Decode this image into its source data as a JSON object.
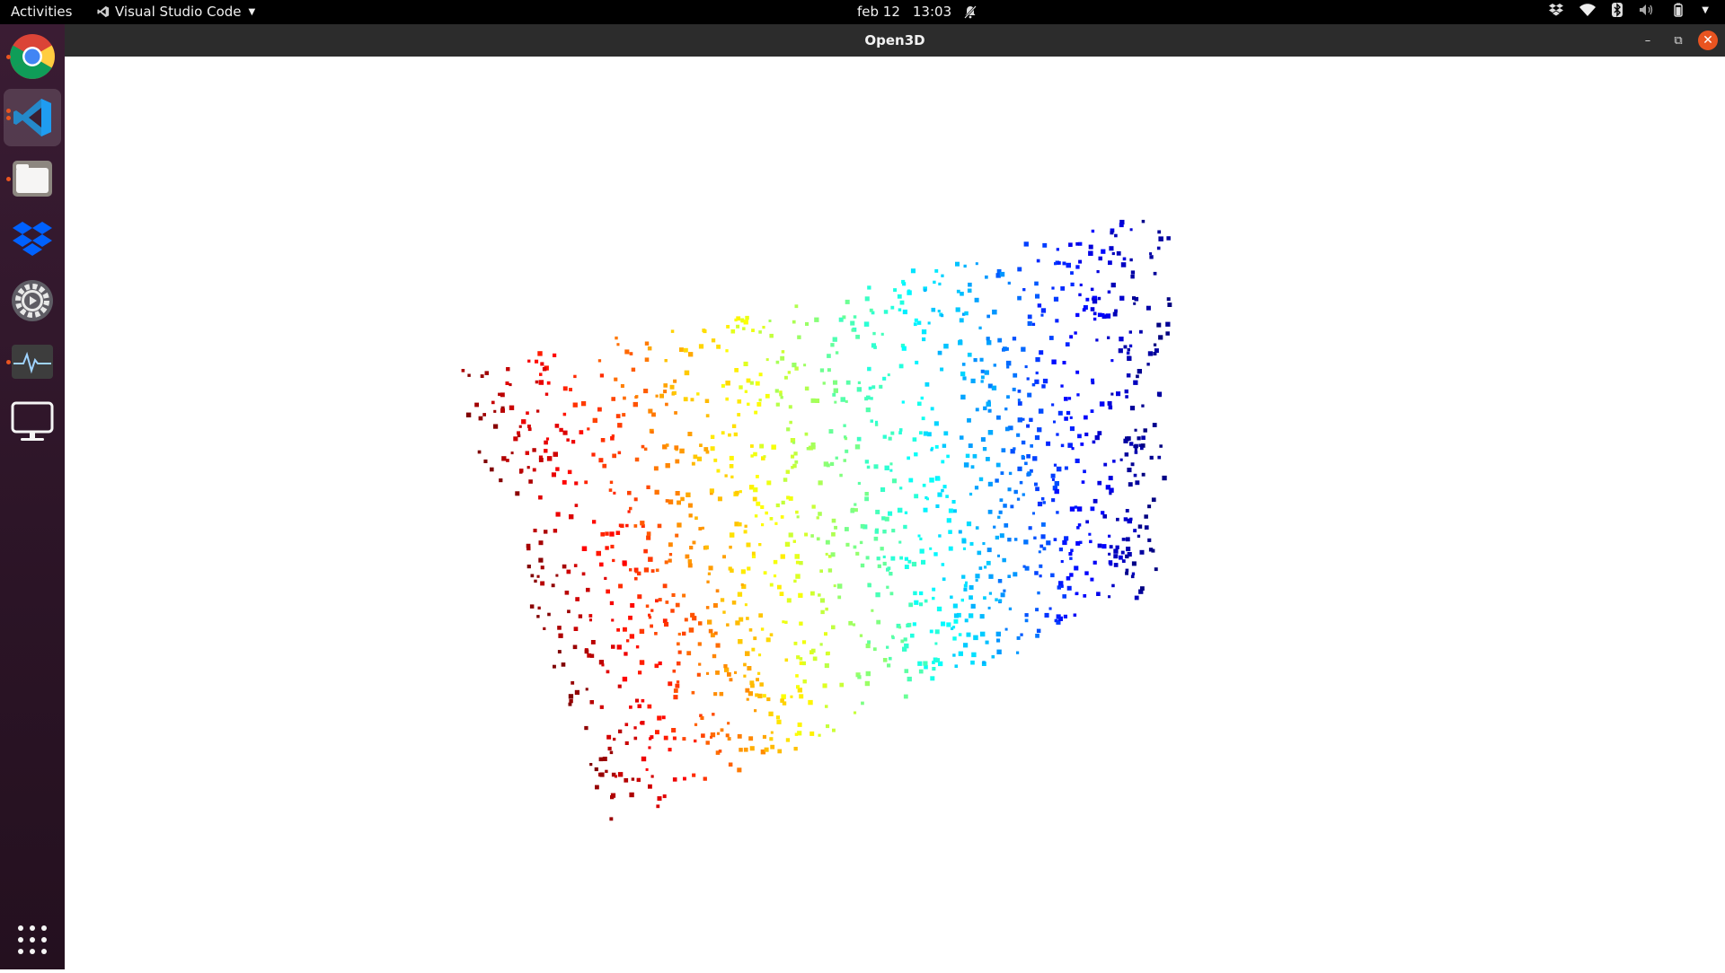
{
  "topbar": {
    "activities": "Activities",
    "app_name": "Visual Studio Code",
    "date": "feb 12",
    "time": "13:03"
  },
  "dock": {
    "items": [
      {
        "name": "chrome-icon",
        "running": true
      },
      {
        "name": "vscode-icon",
        "running": true,
        "active": true
      },
      {
        "name": "files-icon",
        "running": true
      },
      {
        "name": "dropbox-icon",
        "running": false
      },
      {
        "name": "settings-icon",
        "running": false
      },
      {
        "name": "system-monitor-icon",
        "running": true
      },
      {
        "name": "display-icon",
        "running": false
      }
    ],
    "apps_grid_icon": "show-applications-icon"
  },
  "window": {
    "title": "Open3D"
  },
  "point_cloud": {
    "colormap": "jet",
    "description_colors": [
      "#cc0000",
      "#ff6600",
      "#ffcc00",
      "#ffff00",
      "#66ff66",
      "#00ffff",
      "#0099ff",
      "#0000cc"
    ],
    "background": "#ffffff"
  },
  "colors": {
    "accent": "#e95420",
    "topbar_bg": "#000000",
    "titlebar_bg": "#2c2c2c"
  }
}
